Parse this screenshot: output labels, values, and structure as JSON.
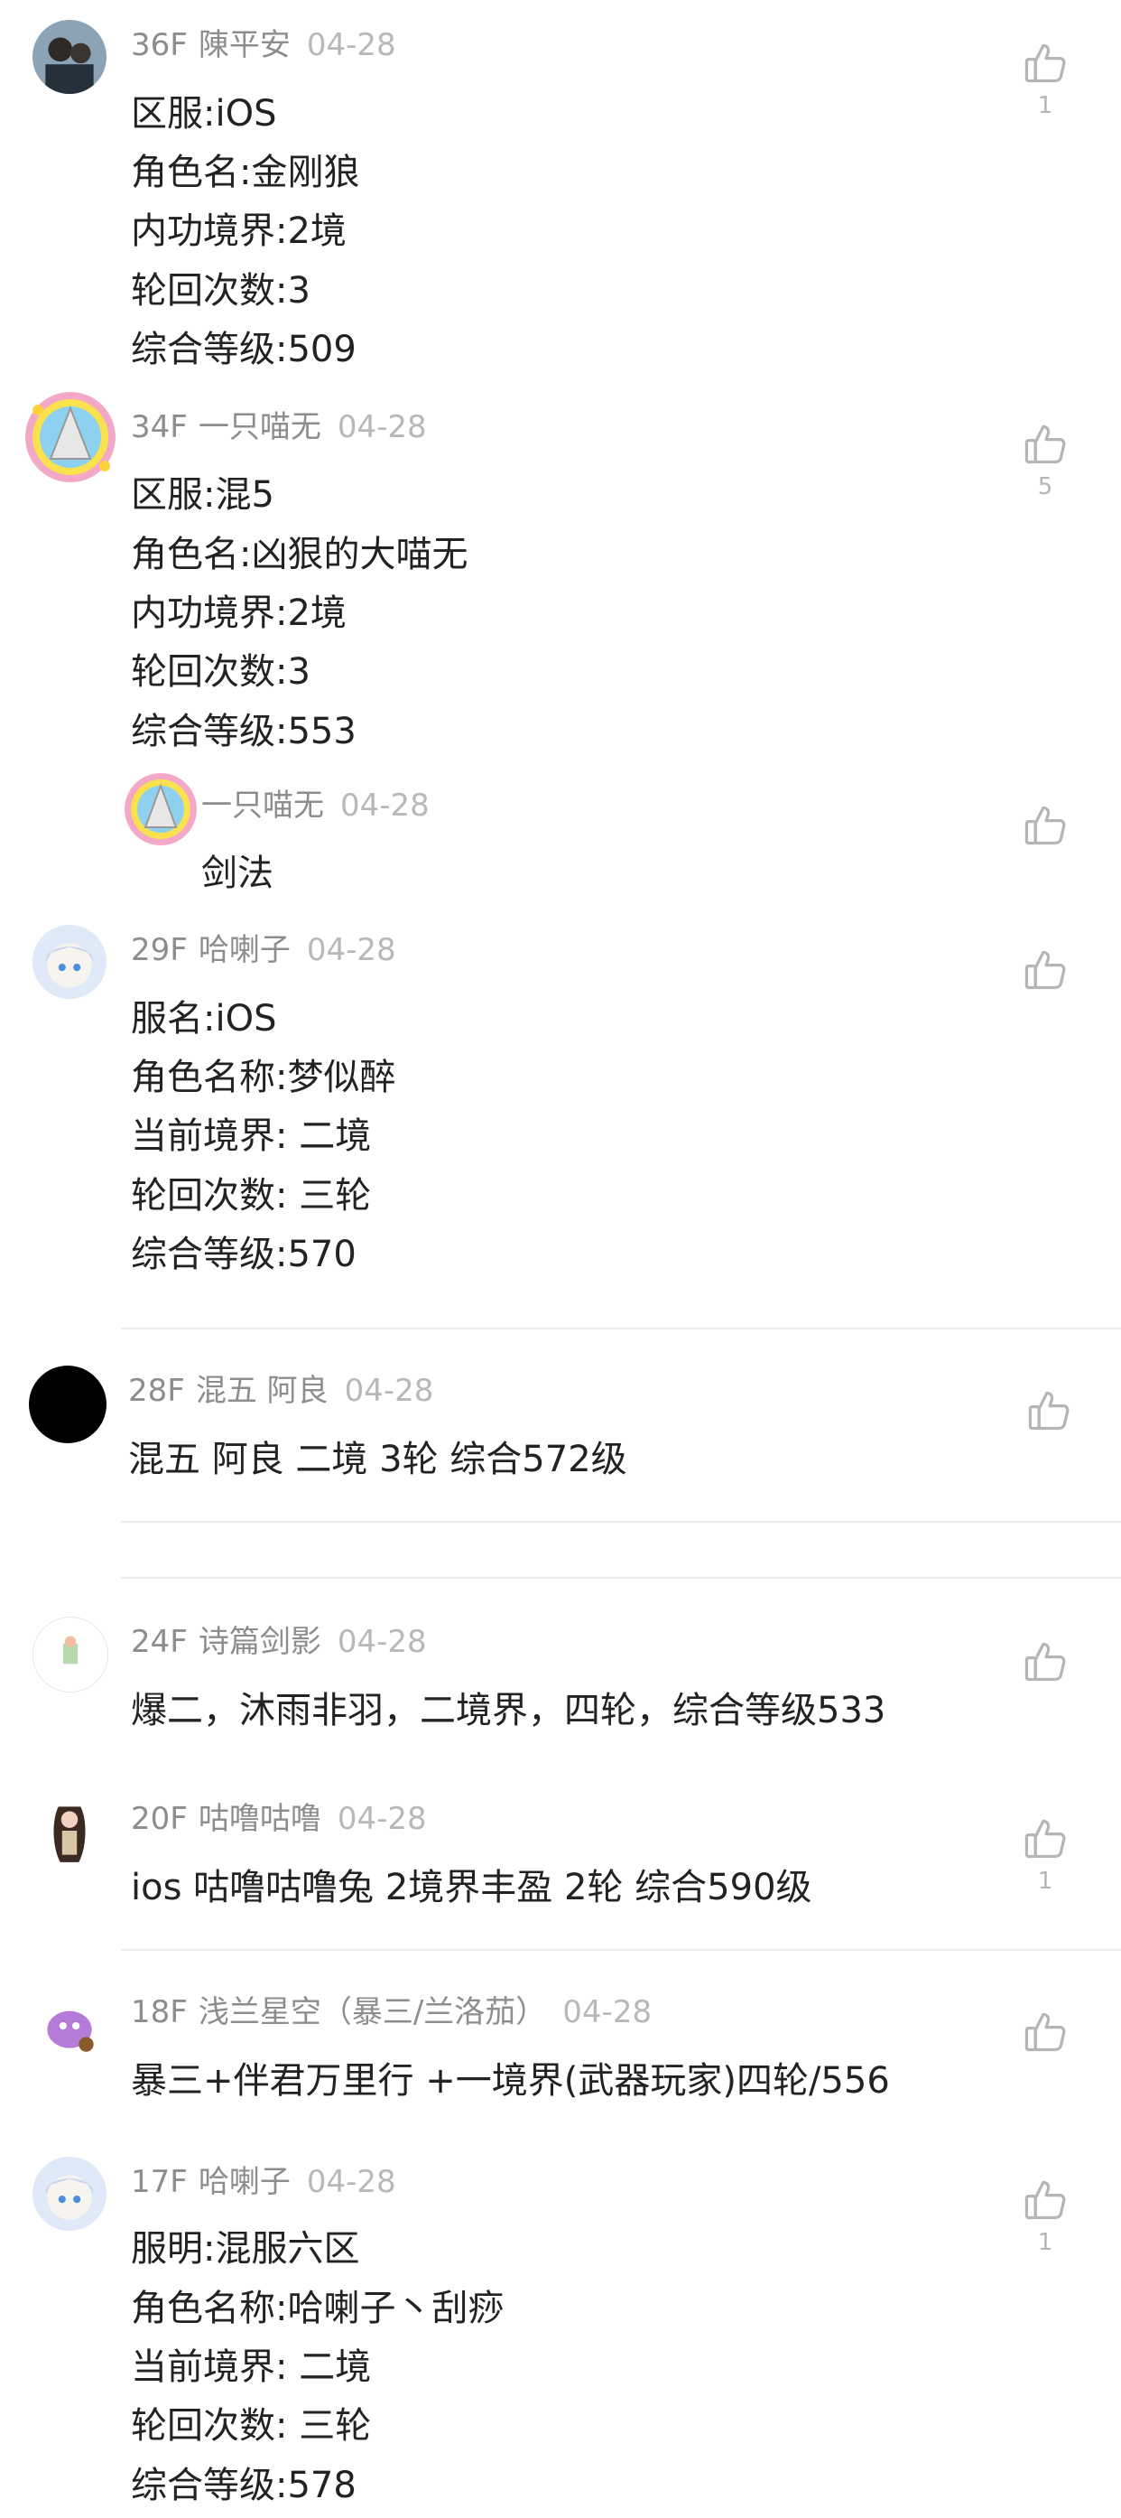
{
  "comments": [
    {
      "floor": "36F",
      "name": "陳平安",
      "date": "04-28",
      "lines": [
        "区服:iOS",
        "角色名:金刚狼",
        "内功境界:2境",
        "轮回次数:3",
        "综合等级:509"
      ],
      "likes": "1"
    },
    {
      "floor": "34F",
      "name": "一只喵无",
      "date": "04-28",
      "lines": [
        "区服:混5",
        "角色名:凶狠的大喵无",
        "内功境界:2境",
        "轮回次数:3",
        "综合等级:553"
      ],
      "likes": "5",
      "reply": {
        "name": "一只喵无",
        "date": "04-28",
        "text": "剑法"
      }
    },
    {
      "floor": "29F",
      "name": "哈喇子",
      "date": "04-28",
      "lines": [
        "服名:iOS",
        "角色名称:梦似醉",
        "当前境界: 二境",
        "轮回次数: 三轮",
        "综合等级:570"
      ]
    },
    {
      "floor": "28F",
      "name": "混五 阿良",
      "date": "04-28",
      "lines": [
        "混五 阿良 二境 3轮 综合572级"
      ]
    },
    {
      "floor": "24F",
      "name": "诗篇剑影",
      "date": "04-28",
      "lines": [
        "爆二，沐雨非羽，二境界，四轮，综合等级533"
      ]
    },
    {
      "floor": "20F",
      "name": "咕噜咕噜",
      "date": "04-28",
      "lines": [
        "ios 咕噜咕噜兔 2境界丰盈 2轮 综合590级"
      ],
      "likes": "1"
    },
    {
      "floor": "18F",
      "name": "浅兰星空（暴三/兰洛茄）",
      "date": "04-28",
      "lines": [
        "暴三+伴君万里行 +一境界(武器玩家)四轮/556"
      ]
    },
    {
      "floor": "17F",
      "name": "哈喇子",
      "date": "04-28",
      "lines": [
        "服明:混服六区",
        "角色名称:哈喇子丶刮痧",
        "当前境界: 二境",
        "轮回次数: 三轮",
        "综合等级:578"
      ],
      "likes": "1"
    }
  ],
  "icons": {
    "like": "thumbs-up-icon"
  },
  "colors": {
    "meta": "#8d8d8d",
    "text": "#222222",
    "icon": "#b5b5b5",
    "divider": "#ececec"
  }
}
